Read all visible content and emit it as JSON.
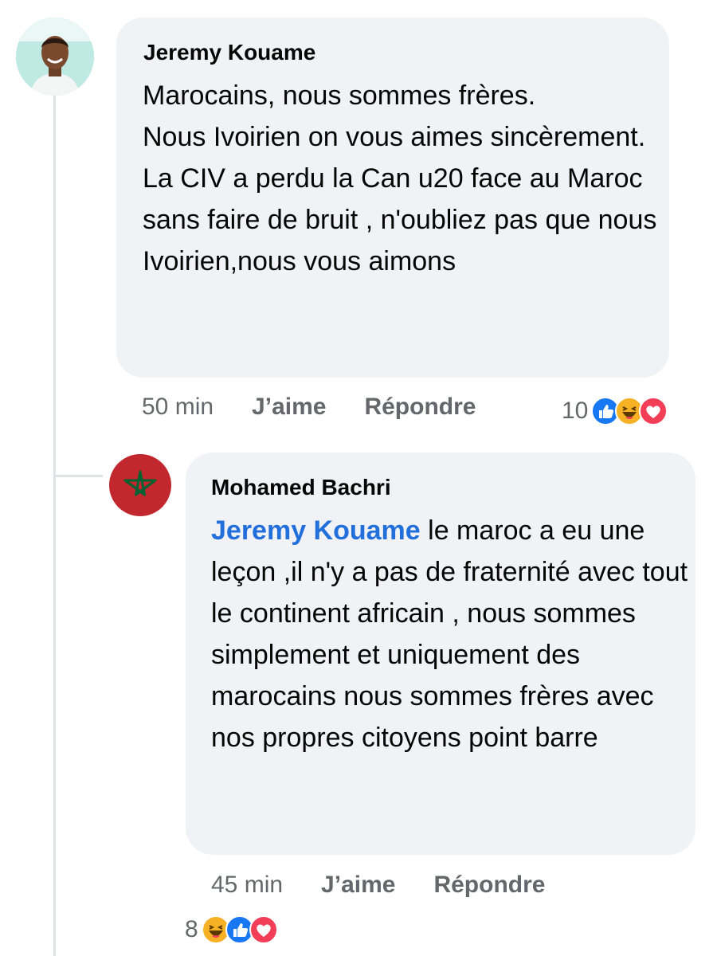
{
  "comments": [
    {
      "author": "Jeremy Kouame",
      "text": "Marocains, nous sommes frères.\nNous Ivoirien on vous aimes sincèrement.\nLa CIV a perdu la Can u20 face au Maroc sans faire de bruit , n'oubliez pas que nous Ivoirien,nous vous aimons",
      "time": "50 min",
      "like_label": "J’aime",
      "reply_label": "Répondre",
      "reaction_count": "10",
      "reactions": [
        "like-icon",
        "haha-icon",
        "love-icon"
      ]
    },
    {
      "author": "Mohamed Bachri",
      "mention": "Jeremy Kouame",
      "text": "  le maroc a eu une leçon  ,il n'y a pas de fraternité  avec tout le continent africain  , nous sommes simplement  et uniquement  des marocains  nous sommes frères  avec  nos propres citoyens point barre",
      "time": "45 min",
      "like_label": "J’aime",
      "reply_label": "Répondre",
      "reaction_count": "8",
      "reactions": [
        "haha-icon",
        "like-icon",
        "love-icon"
      ]
    }
  ],
  "colors": {
    "bubble": "#f0f2f5",
    "mention": "#216fdb",
    "meta": "#65676b",
    "like": "#1877f2",
    "love": "#f33e58",
    "haha": "#f7b125",
    "flag": "#c1272d",
    "star": "#006233"
  }
}
